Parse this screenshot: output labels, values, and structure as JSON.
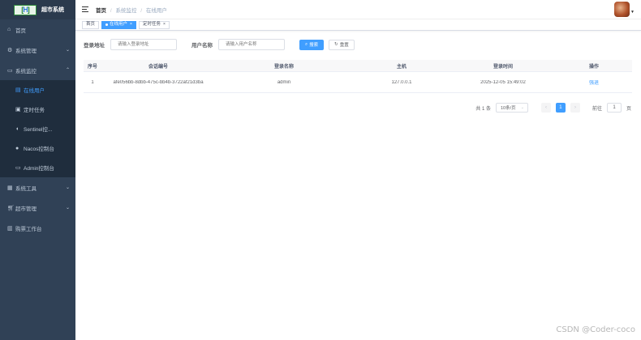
{
  "app": {
    "title": "超市系统",
    "logo_text": "H"
  },
  "sidebar": {
    "items": [
      {
        "label": "首页",
        "icon": "dashboard-icon"
      },
      {
        "label": "系统管理",
        "icon": "gear-icon"
      },
      {
        "label": "系统监控",
        "icon": "monitor-icon"
      },
      {
        "label": "系统工具",
        "icon": "tool-icon"
      },
      {
        "label": "超市管理",
        "icon": "cart-icon"
      },
      {
        "label": "购票工作台",
        "icon": "ticket-icon"
      }
    ],
    "monitor_children": [
      {
        "label": "在线用户",
        "icon": "online-user-icon"
      },
      {
        "label": "定时任务",
        "icon": "timer-icon"
      },
      {
        "label": "Sentinel控...",
        "icon": "sentinel-icon"
      },
      {
        "label": "Nacos控制台",
        "icon": "nacos-icon"
      },
      {
        "label": "Admin控制台",
        "icon": "admin-icon"
      }
    ]
  },
  "breadcrumb": {
    "home": "首页",
    "parent": "系统监控",
    "current": "在线用户"
  },
  "tags": [
    {
      "label": "首页"
    },
    {
      "label": "在线用户"
    },
    {
      "label": "定时任务"
    }
  ],
  "filters": {
    "login_address_label": "登录地址",
    "login_address_placeholder": "请输入登录地址",
    "username_label": "用户名称",
    "username_placeholder": "请输入用户名称",
    "search_label": "搜索",
    "reset_label": "重置"
  },
  "table": {
    "headers": [
      "序号",
      "会话编号",
      "登录名称",
      "主机",
      "登录时间",
      "操作"
    ],
    "rows": [
      {
        "index": "1",
        "token": "afe056bb-8dbb-475c-bb4b-3722af21d3ba",
        "username": "admin",
        "host": "127.0.0.1",
        "login_time": "2025-12-05 15:49:02",
        "action": "强退"
      }
    ]
  },
  "pagination": {
    "total_text": "共 1 条",
    "page_size": "10条/页",
    "current_page": "1",
    "goto_label": "前往",
    "goto_value": "1",
    "page_suffix": "页"
  },
  "watermark": "CSDN @Coder-coco"
}
